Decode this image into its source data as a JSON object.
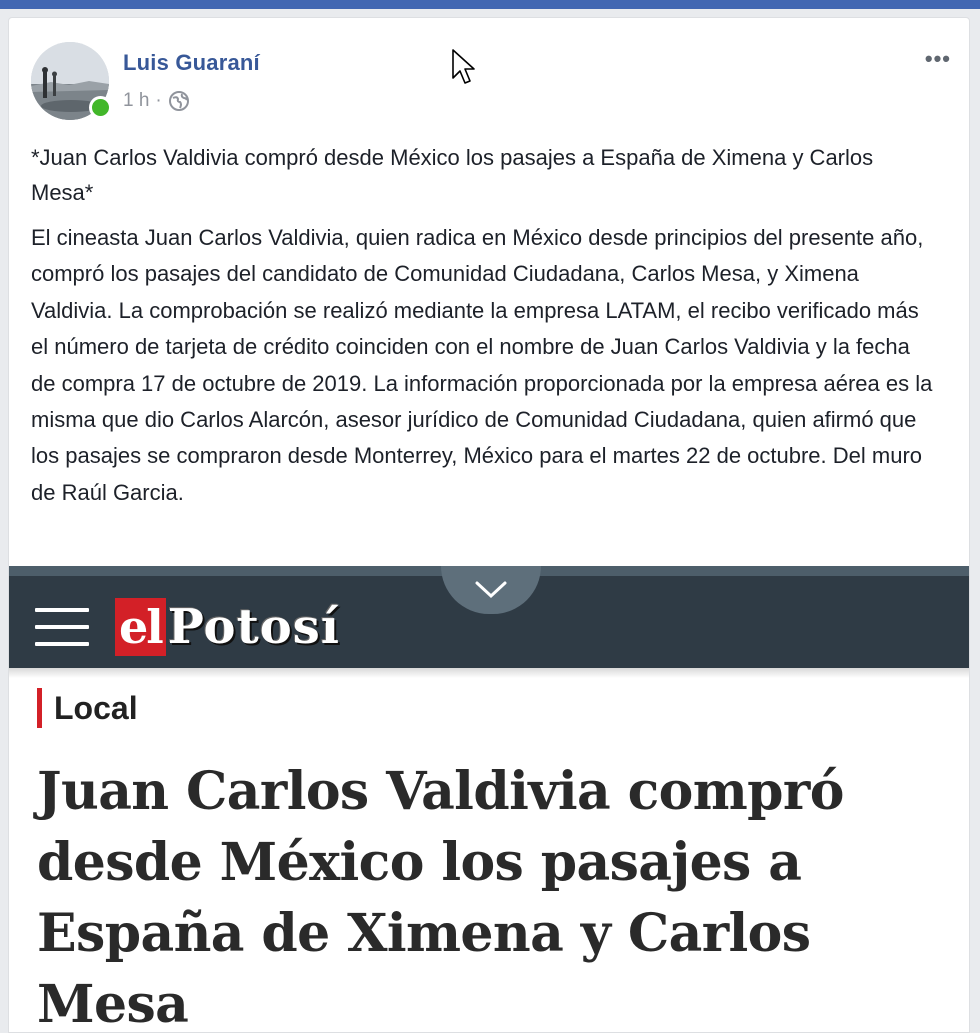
{
  "post": {
    "author": "Luis Guaraní",
    "time": "1 h",
    "separator": "·",
    "audience_icon": "globe-icon",
    "more_icon": "more-options-icon",
    "title": "*Juan Carlos Valdivia compró desde México los pasajes a España de Ximena y Carlos Mesa*",
    "body": "El cineasta Juan Carlos Valdivia, quien radica en México desde principios del presente año, compró los pasajes del candidato de Comunidad Ciudadana, Carlos Mesa, y Ximena Valdivia. La comprobación se realizó mediante la empresa LATAM, el recibo verificado más el número de tarjeta de crédito coinciden con el nombre de Juan Carlos Valdivia y la fecha de compra 17 de octubre de 2019. La información proporcionada por la empresa aérea es la misma que dio Carlos Alarcón, asesor jurídico de Comunidad Ciudadana, quien afirmó que los pasajes se compraron desde Monterrey, México para el martes 22 de octubre. Del muro de Raúl Garcia."
  },
  "shared_article": {
    "logo_el": "el",
    "logo_name": "Potosí",
    "section": "Local",
    "headline": "Juan Carlos Valdivia compró desde México los pasajes a España de Ximena y Carlos Mesa"
  },
  "colors": {
    "facebook_blue": "#4267b2",
    "author_link": "#385898",
    "online_green": "#42b72a",
    "site_header": "#2f3b45",
    "brand_red": "#d32027"
  }
}
